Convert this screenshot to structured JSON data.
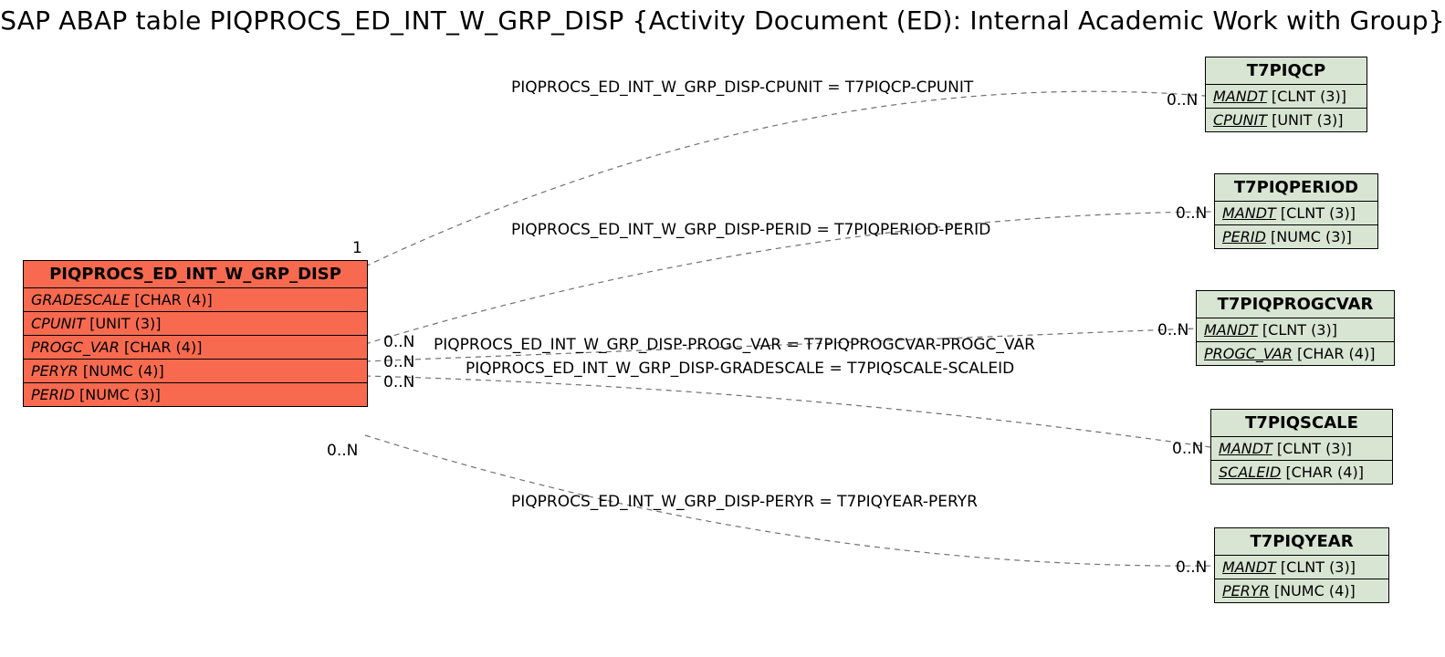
{
  "title": "SAP ABAP table PIQPROCS_ED_INT_W_GRP_DISP {Activity Document (ED): Internal Academic Work with Group}",
  "source_entity": {
    "name": "PIQPROCS_ED_INT_W_GRP_DISP",
    "fields": [
      {
        "name": "GRADESCALE",
        "type": "[CHAR (4)]"
      },
      {
        "name": "CPUNIT",
        "type": "[UNIT (3)]"
      },
      {
        "name": "PROGC_VAR",
        "type": "[CHAR (4)]"
      },
      {
        "name": "PERYR",
        "type": "[NUMC (4)]"
      },
      {
        "name": "PERID",
        "type": "[NUMC (3)]"
      }
    ]
  },
  "targets": [
    {
      "name": "T7PIQCP",
      "fields": [
        {
          "name": "MANDT",
          "type": "[CLNT (3)]"
        },
        {
          "name": "CPUNIT",
          "type": "[UNIT (3)]"
        }
      ],
      "card_in": "0..N"
    },
    {
      "name": "T7PIQPERIOD",
      "fields": [
        {
          "name": "MANDT",
          "type": "[CLNT (3)]"
        },
        {
          "name": "PERID",
          "type": "[NUMC (3)]"
        }
      ],
      "card_in": "0..N"
    },
    {
      "name": "T7PIQPROGCVAR",
      "fields": [
        {
          "name": "MANDT",
          "type": "[CLNT (3)]"
        },
        {
          "name": "PROGC_VAR",
          "type": "[CHAR (4)]"
        }
      ],
      "card_in": "0..N"
    },
    {
      "name": "T7PIQSCALE",
      "fields": [
        {
          "name": "MANDT",
          "type": "[CLNT (3)]"
        },
        {
          "name": "SCALEID",
          "type": "[CHAR (4)]"
        }
      ],
      "card_in": "0..N"
    },
    {
      "name": "T7PIQYEAR",
      "fields": [
        {
          "name": "MANDT",
          "type": "[CLNT (3)]"
        },
        {
          "name": "PERYR",
          "type": "[NUMC (4)]"
        }
      ],
      "card_in": "0..N"
    }
  ],
  "relations": [
    {
      "label": "PIQPROCS_ED_INT_W_GRP_DISP-CPUNIT = T7PIQCP-CPUNIT",
      "src_card": "1"
    },
    {
      "label": "PIQPROCS_ED_INT_W_GRP_DISP-PERID = T7PIQPERIOD-PERID",
      "src_card": "0..N"
    },
    {
      "label": "PIQPROCS_ED_INT_W_GRP_DISP-PROGC_VAR = T7PIQPROGCVAR-PROGC_VAR",
      "src_card": "0..N"
    },
    {
      "label": "PIQPROCS_ED_INT_W_GRP_DISP-GRADESCALE = T7PIQSCALE-SCALEID",
      "src_card": "0..N"
    },
    {
      "label": "PIQPROCS_ED_INT_W_GRP_DISP-PERYR = T7PIQYEAR-PERYR",
      "src_card": "0..N"
    }
  ]
}
